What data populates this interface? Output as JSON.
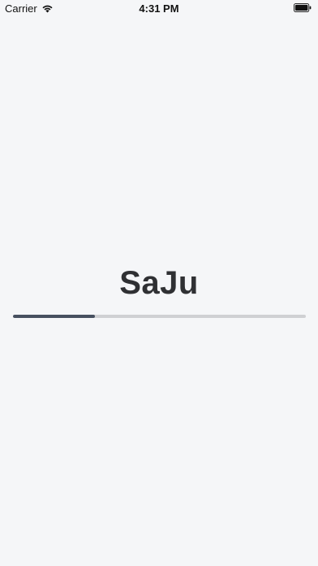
{
  "status_bar": {
    "carrier": "Carrier",
    "time": "4:31 PM",
    "icons": [
      "wifi-icon",
      "battery-icon"
    ]
  },
  "splash": {
    "title": "SaJu",
    "progress": 0.28,
    "progress_fill_color": "#475060",
    "progress_track_color": "#cfd0d3"
  }
}
